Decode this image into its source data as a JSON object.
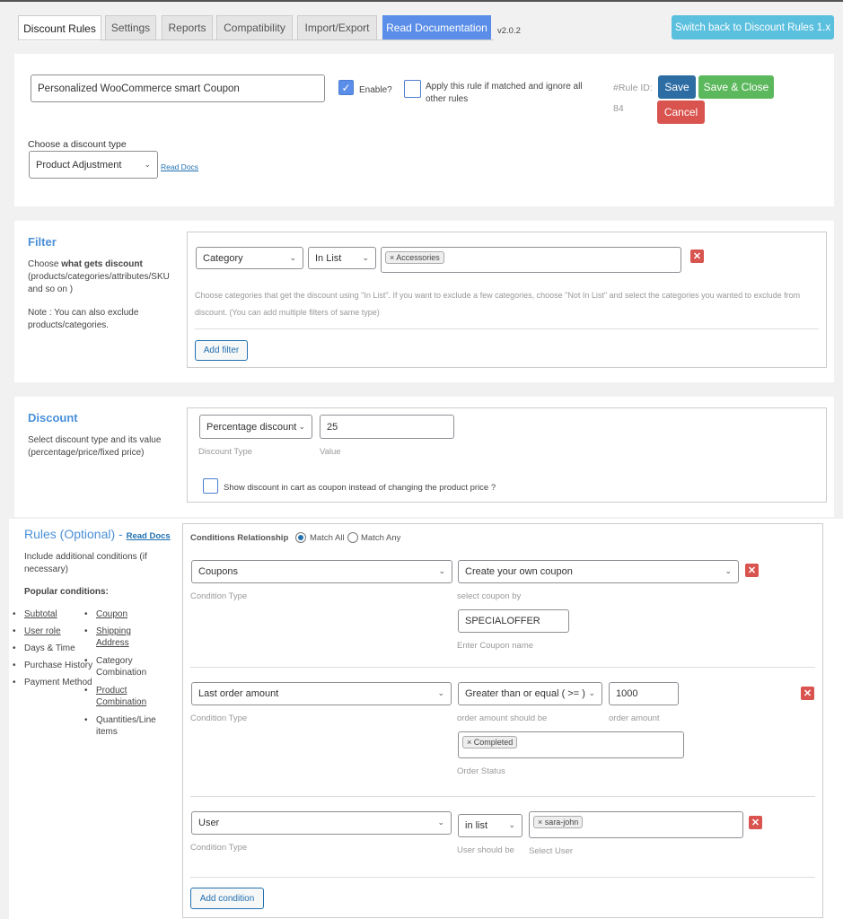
{
  "tabs": [
    "Discount Rules",
    "Settings",
    "Reports",
    "Compatibility",
    "Import/Export",
    "Read Documentation"
  ],
  "version": "v2.0.2",
  "switch_back": "Switch back to Discount Rules 1.x",
  "rule": {
    "title": "Personalized WooCommerce smart Coupon",
    "enable_label": "Enable?",
    "enabled": true,
    "apply_label": "Apply this rule if matched and ignore all other rules",
    "apply_checked": false,
    "rule_id_label": "#Rule ID:",
    "rule_id": "84",
    "save": "Save",
    "save_close": "Save & Close",
    "cancel": "Cancel",
    "discount_type_label": "Choose a discount type",
    "discount_type": "Product Adjustment",
    "read_docs": "Read Docs"
  },
  "filter": {
    "title": "Filter",
    "desc_prefix": "Choose ",
    "desc_bold": "what gets discount",
    "desc_rest": "(products/categories/attributes/SKU and so on )",
    "note": "Note : You can also exclude products/categories.",
    "type": "Category",
    "op": "In List",
    "tag": "× Accessories",
    "help": "Choose categories that get the discount using \"In List\". If you want to exclude a few categories, choose \"Not In List\" and select the categories you wanted to exclude from discount. (You can add multiple filters of same type)",
    "add": "Add filter"
  },
  "discount": {
    "title": "Discount",
    "desc": "Select discount type and its value (percentage/price/fixed price)",
    "type": "Percentage discount",
    "value": "25",
    "type_label": "Discount Type",
    "value_label": "Value",
    "coupon_label": "Show discount in cart as coupon instead of changing the product price ?"
  },
  "rules": {
    "title": "Rules (Optional)",
    "dash": "-",
    "read_docs": "Read Docs",
    "desc": "Include additional conditions (if necessary)",
    "popular": "Popular conditions:",
    "col1": [
      {
        "t": "Subtotal",
        "link": true
      },
      {
        "t": "User role",
        "link": true
      },
      {
        "t": "Days & Time",
        "link": false
      },
      {
        "t": "Purchase History",
        "link": false
      },
      {
        "t": "Payment Method",
        "link": false
      }
    ],
    "col2": [
      {
        "t": "Coupon",
        "link": true
      },
      {
        "t": "Shipping Address",
        "link": true
      },
      {
        "t": "Category Combination",
        "link": false
      },
      {
        "t": "Product Combination",
        "link": true
      },
      {
        "t": "Quantities/Line items",
        "link": false
      }
    ],
    "relationship": "Conditions Relationship",
    "match_all": "Match All",
    "match_any": "Match Any",
    "selected": "Match All",
    "condition_type_label": "Condition Type",
    "c1": {
      "type": "Coupons",
      "by": "Create your own coupon",
      "by_label": "select coupon by",
      "coupon": "SPECIALOFFER",
      "coupon_label": "Enter Coupon name"
    },
    "c2": {
      "type": "Last order amount",
      "op": "Greater than or equal ( >= )",
      "op_label": "order amount should be",
      "amount": "1000",
      "amount_label": "order amount",
      "status": "× Completed",
      "status_label": "Order Status"
    },
    "c3": {
      "type": "User",
      "op": "in list",
      "op_label": "User should be",
      "user": "× sara-john",
      "user_label": "Select User"
    },
    "add": "Add condition"
  },
  "colors": {
    "accent": "#4a90d9",
    "save": "#2e6da4",
    "save_close": "#5cb85c",
    "cancel": "#d9534f",
    "switch": "#5bc0de"
  }
}
